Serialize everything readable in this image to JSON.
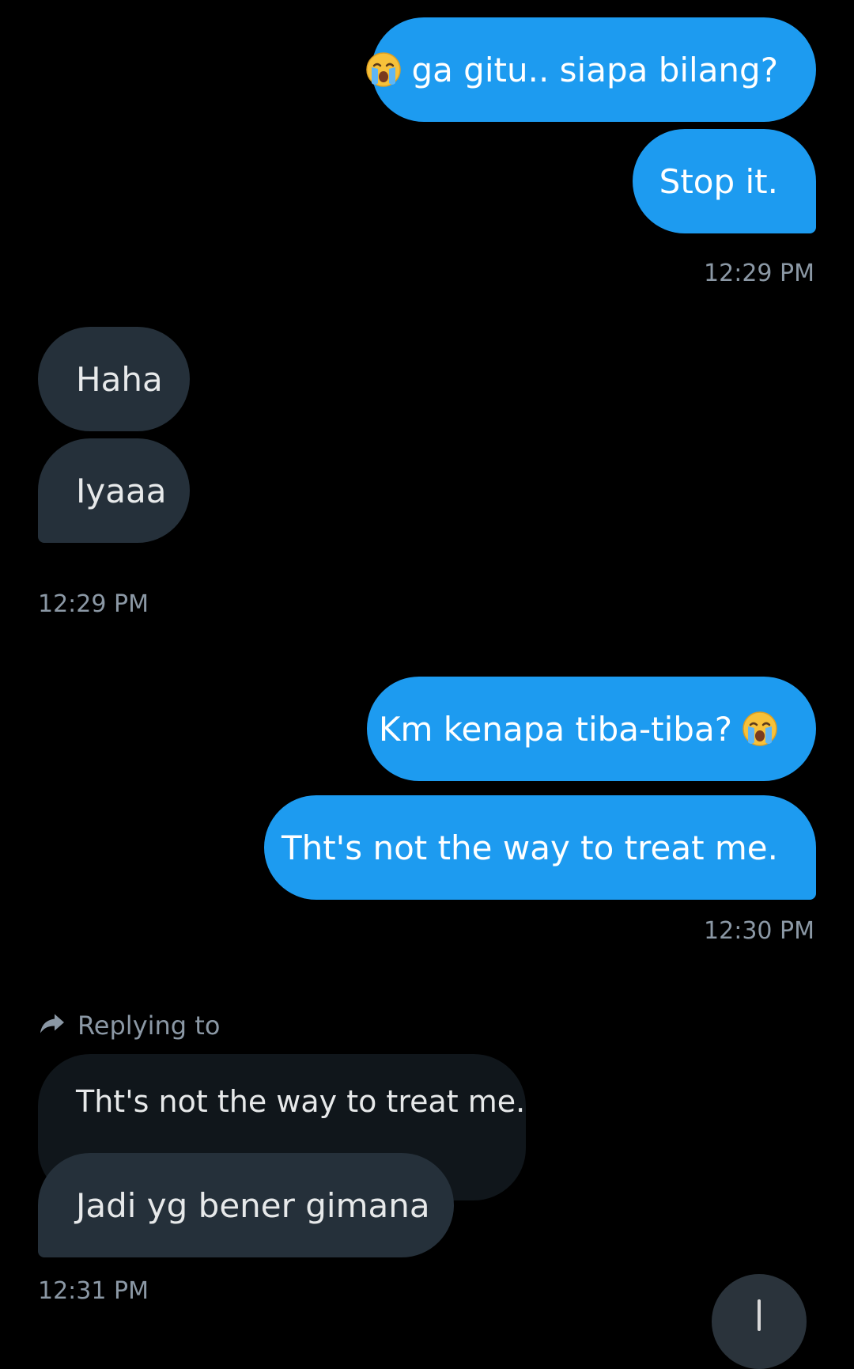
{
  "messages": [
    {
      "side": "sent",
      "text": "ga gitu.. siapa bilang?",
      "emoji": "crying-face"
    },
    {
      "side": "sent",
      "text": "Stop it."
    },
    {
      "side": "recv",
      "text": "Haha"
    },
    {
      "side": "recv",
      "text": "Iyaaa"
    },
    {
      "side": "sent",
      "text": "Km kenapa tiba-tiba?",
      "emoji": "crying-face"
    },
    {
      "side": "sent",
      "text": "Tht's not the way to treat me."
    },
    {
      "side": "recv",
      "text": "Jadi yg bener gimana"
    }
  ],
  "timestamps": [
    "12:29 PM",
    "12:29 PM",
    "12:30 PM",
    "12:31 PM"
  ],
  "reply": {
    "label": "Replying to",
    "quoted_text": "Tht's not the way to treat me."
  },
  "colors": {
    "background": "#000000",
    "sent_bubble": "#1d9bf0",
    "received_bubble": "#25303a",
    "quoted_bubble": "#10161b",
    "timestamp": "#8b98a5"
  },
  "icons": {
    "emoji": "crying-face-emoji",
    "reply": "reply-arrow-icon",
    "scroll_button": "scroll-down-icon"
  }
}
